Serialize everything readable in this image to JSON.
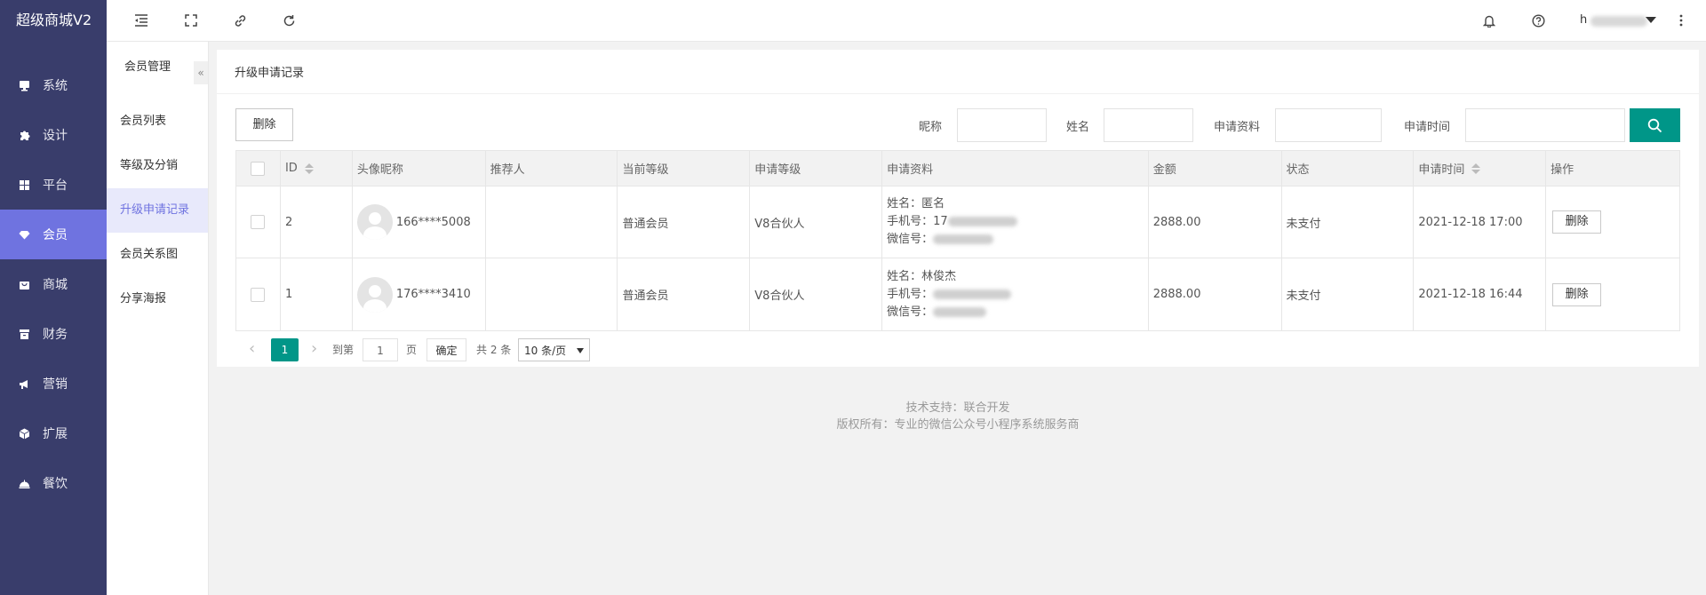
{
  "app": {
    "brand": "超级商城V2"
  },
  "sidebar": {
    "items": [
      {
        "label": "系统",
        "icon": "monitor-icon",
        "active": false
      },
      {
        "label": "设计",
        "icon": "puzzle-icon",
        "active": false
      },
      {
        "label": "平台",
        "icon": "grid-icon",
        "active": false
      },
      {
        "label": "会员",
        "icon": "diamond-icon",
        "active": true
      },
      {
        "label": "商城",
        "icon": "shop-icon",
        "active": false
      },
      {
        "label": "财务",
        "icon": "archive-icon",
        "active": false
      },
      {
        "label": "营销",
        "icon": "megaphone-icon",
        "active": false
      },
      {
        "label": "扩展",
        "icon": "cube-icon",
        "active": false
      },
      {
        "label": "餐饮",
        "icon": "dish-icon",
        "active": false
      }
    ]
  },
  "header": {
    "user_prefix": "h"
  },
  "subnav": {
    "title": "会员管理",
    "collapse": "«",
    "items": [
      {
        "label": "会员列表",
        "active": false
      },
      {
        "label": "等级及分销",
        "active": false
      },
      {
        "label": "升级申请记录",
        "active": true
      },
      {
        "label": "会员关系图",
        "active": false
      },
      {
        "label": "分享海报",
        "active": false
      }
    ]
  },
  "page": {
    "title": "升级申请记录",
    "delete_label": "删除",
    "filters": {
      "nickname_label": "昵称",
      "name_label": "姓名",
      "material_label": "申请资料",
      "time_label": "申请时间"
    }
  },
  "table": {
    "headers": [
      "ID",
      "头像昵称",
      "推荐人",
      "当前等级",
      "申请等级",
      "申请资料",
      "金额",
      "状态",
      "申请时间",
      "操作"
    ],
    "rows": [
      {
        "id": "2",
        "nickname": "166****5008",
        "referrer": "",
        "current_level": "普通会员",
        "apply_level": "V8合伙人",
        "info_name": "姓名：匿名",
        "info_phone": "手机号：17",
        "info_wechat": "微信号：",
        "amount": "2888.00",
        "status": "未支付",
        "time": "2021-12-18 17:00",
        "action": "删除"
      },
      {
        "id": "1",
        "nickname": "176****3410",
        "referrer": "",
        "current_level": "普通会员",
        "apply_level": "V8合伙人",
        "info_name": "姓名：林俊杰",
        "info_phone": "手机号：",
        "info_wechat": "微信号：",
        "amount": "2888.00",
        "status": "未支付",
        "time": "2021-12-18 16:44",
        "action": "删除"
      }
    ]
  },
  "pagination": {
    "prev": "‹",
    "current": "1",
    "next": "›",
    "goto": "到第",
    "page_value": "1",
    "page_unit": "页",
    "confirm": "确定",
    "total": "共 2 条",
    "per_page": "10 条/页"
  },
  "footer": {
    "line1": "技术支持：联合开发",
    "line2": "版权所有：专业的微信公众号小程序系统服务商"
  },
  "colors": {
    "sidebar": "#393D6B",
    "active": "#6F73E0",
    "primary": "#009688"
  }
}
